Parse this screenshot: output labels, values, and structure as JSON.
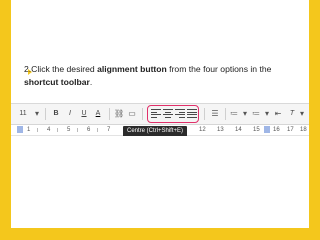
{
  "instruction": {
    "prefix": "2.Click the desired ",
    "bold1": "alignment button",
    "middle": " from the four options in the ",
    "bold2": "shortcut toolbar",
    "suffix": "."
  },
  "toolbar": {
    "font_size": "11",
    "font_size_arrow": "▾",
    "bold": "B",
    "italic": "I",
    "underline": "U",
    "text_color": "A",
    "clear_format": "T",
    "clear_format_arrow": "▾",
    "more": "⋮"
  },
  "tooltip": {
    "text": "Centre (Ctrl+Shift+E)"
  },
  "ruler": {
    "numbers": [
      "1",
      "4",
      "5",
      "6",
      "7",
      "8",
      "12",
      "13",
      "14",
      "15",
      "16",
      "17",
      "18"
    ]
  },
  "colors": {
    "accent": "#f4c71c",
    "highlight": "#e0306a",
    "tooltip_bg": "#2b2b2b"
  }
}
